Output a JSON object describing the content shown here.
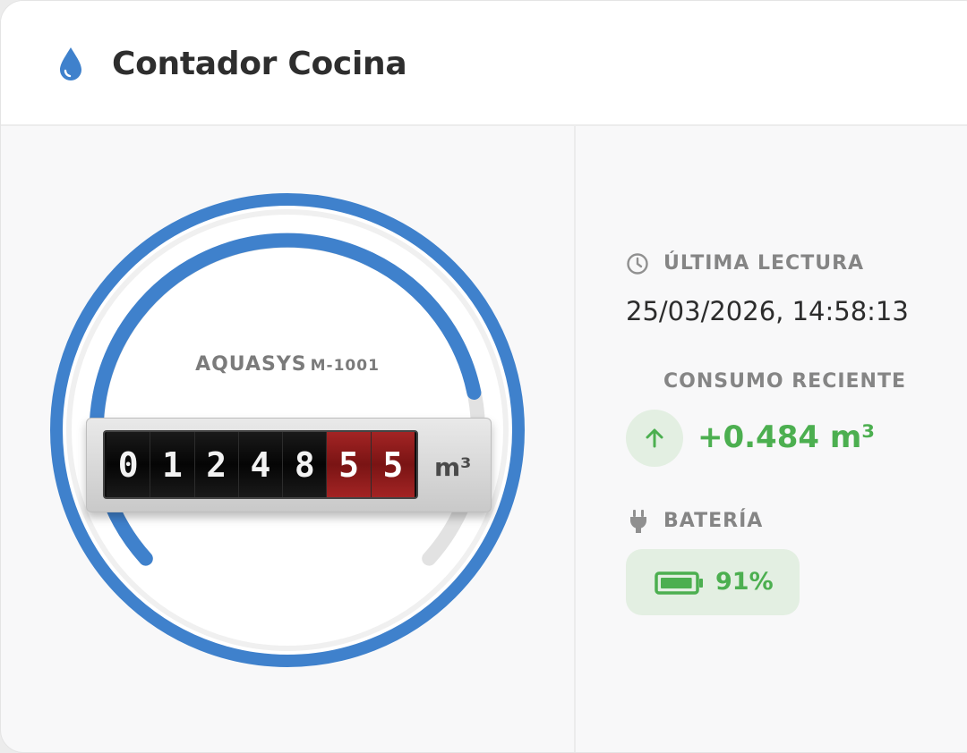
{
  "header": {
    "title": "Contador Cocina",
    "icon": "water-drop-icon"
  },
  "meter": {
    "brand": "AQUASYS",
    "model": "M-1001",
    "digits": [
      "0",
      "1",
      "2",
      "4",
      "8",
      "5",
      "5"
    ],
    "unit": "m³",
    "colors": {
      "ring": "#3f81cc",
      "track": "#e0e0e0",
      "red_drum": "#9a1e1e"
    }
  },
  "last_reading": {
    "label": "ÚLTIMA LECTURA",
    "icon": "clock-icon",
    "value": "25/03/2026, 14:58:13"
  },
  "recent_consumption": {
    "label": "CONSUMO RECIENTE",
    "icon": "arrow-up-icon",
    "value": "+0.484 m³",
    "color": "#4caf50"
  },
  "battery": {
    "label": "BATERÍA",
    "icon": "plug-icon",
    "value": "91%",
    "level": 0.91,
    "color": "#4caf50"
  }
}
